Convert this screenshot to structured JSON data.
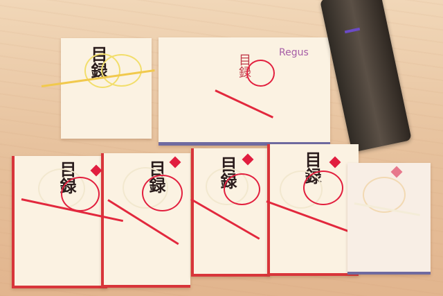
{
  "scene": {
    "description_text": ""
  },
  "labels": {
    "envelope_title": "目録",
    "logo_text": "Regus"
  }
}
